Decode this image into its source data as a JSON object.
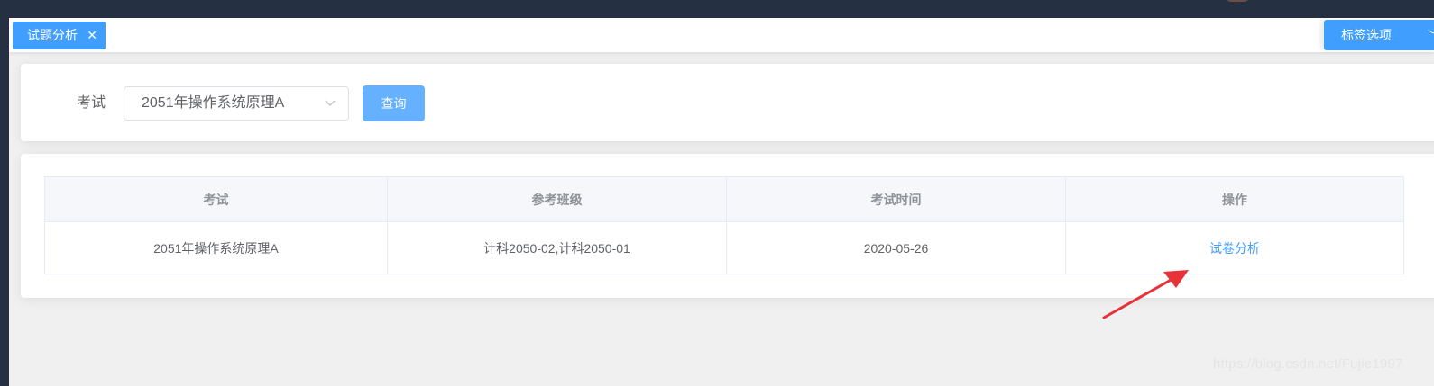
{
  "tags": {
    "active_tag": "试题分析",
    "close_glyph": "✕",
    "options_label": "标签选项",
    "options_chevron": "﹀"
  },
  "search": {
    "label": "考试",
    "selected_exam": "2051年操作系统原理A",
    "query_button": "查询"
  },
  "table": {
    "headers": [
      "考试",
      "参考班级",
      "考试时间",
      "操作"
    ],
    "rows": [
      {
        "exam": "2051年操作系统原理A",
        "classes": "计科2050-02,计科2050-01",
        "time": "2020-05-26",
        "action": "试卷分析"
      }
    ]
  },
  "watermark": "https://blog.csdn.net/Fujie1997",
  "colors": {
    "primary": "#409eff",
    "annotation_arrow": "#e8323a",
    "topbar": "#263043"
  }
}
